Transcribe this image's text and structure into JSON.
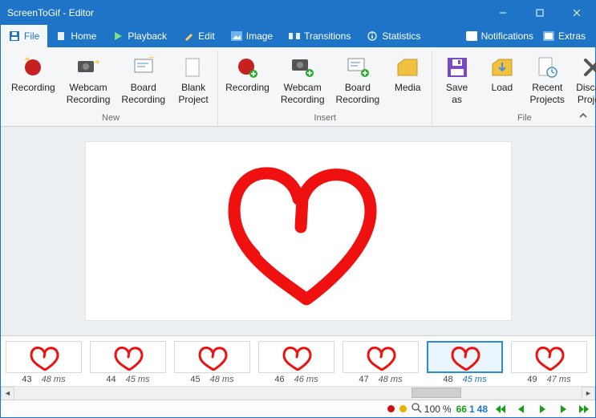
{
  "window": {
    "title": "ScreenToGif - Editor"
  },
  "titlebar_right": {
    "notifications": "Notifications",
    "extras": "Extras"
  },
  "menu": {
    "file": "File",
    "home": "Home",
    "playback": "Playback",
    "edit": "Edit",
    "image": "Image",
    "transitions": "Transitions",
    "statistics": "Statistics"
  },
  "ribbon": {
    "groups": {
      "new": {
        "label": "New",
        "recording": "Recording",
        "webcam": "Webcam\nRecording",
        "board": "Board\nRecording",
        "blank": "Blank\nProject"
      },
      "insert": {
        "label": "Insert",
        "recording": "Recording",
        "webcam": "Webcam\nRecording",
        "board": "Board\nRecording",
        "media": "Media"
      },
      "file": {
        "label": "File",
        "saveas": "Save as",
        "load": "Load",
        "recent": "Recent\nProjects",
        "discard": "Discard\nProject"
      }
    }
  },
  "frames": [
    {
      "index": "43",
      "duration": "48 ms"
    },
    {
      "index": "44",
      "duration": "45 ms"
    },
    {
      "index": "45",
      "duration": "48 ms"
    },
    {
      "index": "46",
      "duration": "46 ms"
    },
    {
      "index": "47",
      "duration": "48 ms"
    },
    {
      "index": "48",
      "duration": "45 ms",
      "selected": true
    },
    {
      "index": "49",
      "duration": "47 ms"
    }
  ],
  "status": {
    "zoom": "100",
    "zoom_pct": "%",
    "total": "66",
    "selected": "1",
    "current": "48"
  }
}
